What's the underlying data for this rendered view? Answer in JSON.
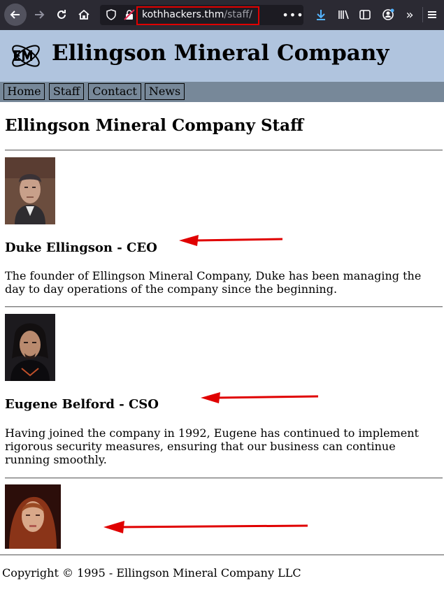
{
  "browser": {
    "url_host": "kothhackers.thm",
    "url_path": "/staff/",
    "menu_dots": "•••",
    "overflow_label": "»"
  },
  "site": {
    "title": "Ellingson Mineral Company",
    "nav": [
      {
        "label": "Home"
      },
      {
        "label": "Staff"
      },
      {
        "label": "Contact"
      },
      {
        "label": "News"
      }
    ]
  },
  "page": {
    "heading": "Ellingson Mineral Company Staff",
    "staff": [
      {
        "name": "Duke Ellingson - CEO",
        "description": "The founder of Ellingson Mineral Company, Duke has been managing the day to day operations of the company since the beginning."
      },
      {
        "name": "Eugene Belford - CSO",
        "description": "Having joined the company in 1992, Eugene has continued to implement rigorous security measures, ensuring that our business can continue running smoothly."
      }
    ],
    "footer": "Copyright © 1995 - Ellingson Mineral Company LLC"
  },
  "colors": {
    "header_bg": "#b0c4de",
    "nav_bg": "#778899",
    "annotation_red": "#e00000",
    "toolbar_bg": "#2b2a33"
  }
}
